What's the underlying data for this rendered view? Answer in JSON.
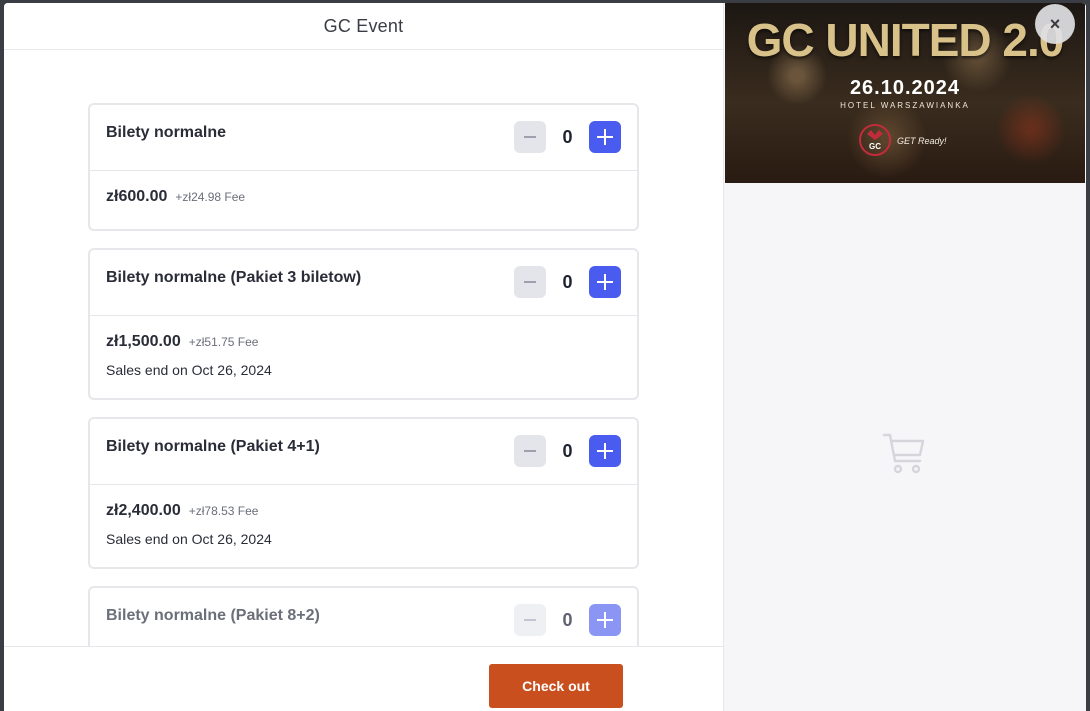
{
  "modal": {
    "title": "GC Event"
  },
  "tickets": [
    {
      "name": "Bilety normalne",
      "quantity": "0",
      "price": "zł600.00",
      "fee": "+zł24.98 Fee",
      "sales_end": ""
    },
    {
      "name": "Bilety normalne (Pakiet 3 biletow)",
      "quantity": "0",
      "price": "zł1,500.00",
      "fee": "+zł51.75 Fee",
      "sales_end": "Sales end on Oct 26, 2024"
    },
    {
      "name": "Bilety normalne (Pakiet 4+1)",
      "quantity": "0",
      "price": "zł2,400.00",
      "fee": "+zł78.53 Fee",
      "sales_end": "Sales end on Oct 26, 2024"
    },
    {
      "name": "Bilety normalne (Pakiet 8+2)",
      "quantity": "0",
      "price": "",
      "fee": "",
      "sales_end": ""
    }
  ],
  "footer": {
    "checkout_label": "Check out"
  },
  "banner": {
    "title": "GC UNITED 2.0",
    "date": "26.10.2024",
    "venue": "HOTEL WARSZAWIANKA",
    "slogan": "GET Ready!",
    "logo_text": "GC"
  },
  "close_label": "×",
  "icons": {
    "close": "close-icon",
    "cart": "cart-icon",
    "minus": "minus-icon",
    "plus": "plus-icon"
  },
  "colors": {
    "accent": "#4a5cf0",
    "checkout": "#c9501e",
    "panel": "#f6f6f9"
  }
}
